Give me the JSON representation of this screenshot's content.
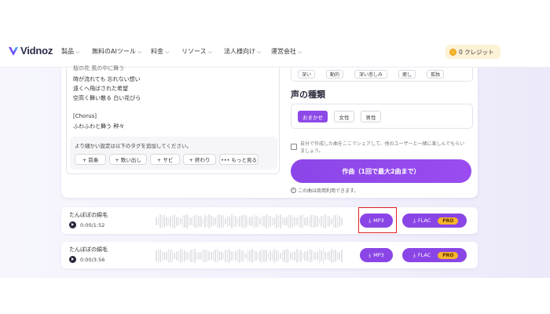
{
  "brand": {
    "name": "Vidnoz"
  },
  "nav": {
    "items": [
      {
        "label": "製品"
      },
      {
        "label": "無料のAIツール"
      },
      {
        "label": "料金"
      },
      {
        "label": "リソース"
      },
      {
        "label": "法人様向け"
      },
      {
        "label": "運営会社"
      }
    ],
    "credits_label": "0 クレジット"
  },
  "lyrics": {
    "lines": [
      "時が流れても 忘れない想い",
      "遠くへ飛ばされた希望",
      "空高く舞い散る 白い花びら",
      "",
      "[Chorus]",
      "ふわふわと舞う 种々"
    ],
    "tag_hint": "より細かい設定は以下のタグを追加してください。",
    "tags": [
      "+ 前奏",
      "+ 歌い出し",
      "+ サビ",
      "+ 終わり",
      "••• もっと見る"
    ]
  },
  "mood_tags": [
    "深い",
    "動的",
    "深い悲しみ",
    "癒し",
    "孤独"
  ],
  "voice": {
    "title": "声の種類",
    "options": [
      {
        "label": "おまかせ",
        "selected": true
      },
      {
        "label": "女性",
        "selected": false
      },
      {
        "label": "男性",
        "selected": false
      }
    ]
  },
  "share": {
    "line1": "自分で作成した曲をここでシェアして、他のユーザーと一緒に楽しんでもらい",
    "line2": "ましょう。",
    "checked": false
  },
  "compose_button": "作曲（1回で最大2曲まで）",
  "license_note": "この曲は商用利用できます。",
  "tracks": [
    {
      "title": "たんぽぽの綿毛",
      "time": "0:00/1:52",
      "mp3_label": "MP3",
      "flac_label": "FLAC",
      "pro_label": "PRO"
    },
    {
      "title": "たんぽぽの綿毛",
      "time": "0:00/3:56",
      "mp3_label": "MP3",
      "flac_label": "FLAC",
      "pro_label": "PRO"
    }
  ],
  "icons": {
    "logo": "vidnoz-logo-icon",
    "chevron": "chevron-down-icon",
    "credits": "coin-icon",
    "play": "play-icon",
    "download": "download-icon",
    "license": "creative-commons-icon"
  },
  "colors": {
    "accent": "#8a45e6",
    "pro_badge": "#f6b52b",
    "credits_bg": "#fdf1d6",
    "highlight": "#e02020"
  }
}
